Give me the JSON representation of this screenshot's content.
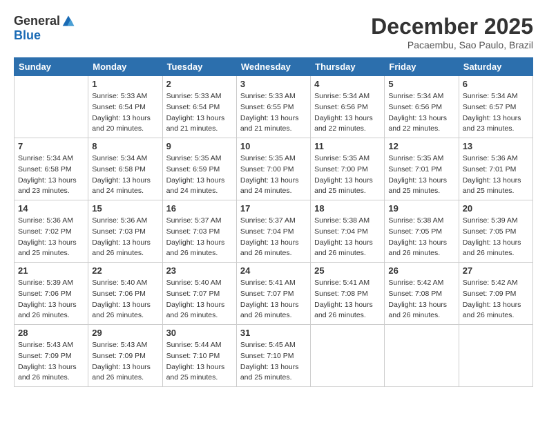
{
  "header": {
    "logo_general": "General",
    "logo_blue": "Blue",
    "month": "December 2025",
    "location": "Pacaembu, Sao Paulo, Brazil"
  },
  "weekdays": [
    "Sunday",
    "Monday",
    "Tuesday",
    "Wednesday",
    "Thursday",
    "Friday",
    "Saturday"
  ],
  "weeks": [
    [
      {
        "day": "",
        "info": ""
      },
      {
        "day": "1",
        "info": "Sunrise: 5:33 AM\nSunset: 6:54 PM\nDaylight: 13 hours\nand 20 minutes."
      },
      {
        "day": "2",
        "info": "Sunrise: 5:33 AM\nSunset: 6:54 PM\nDaylight: 13 hours\nand 21 minutes."
      },
      {
        "day": "3",
        "info": "Sunrise: 5:33 AM\nSunset: 6:55 PM\nDaylight: 13 hours\nand 21 minutes."
      },
      {
        "day": "4",
        "info": "Sunrise: 5:34 AM\nSunset: 6:56 PM\nDaylight: 13 hours\nand 22 minutes."
      },
      {
        "day": "5",
        "info": "Sunrise: 5:34 AM\nSunset: 6:56 PM\nDaylight: 13 hours\nand 22 minutes."
      },
      {
        "day": "6",
        "info": "Sunrise: 5:34 AM\nSunset: 6:57 PM\nDaylight: 13 hours\nand 23 minutes."
      }
    ],
    [
      {
        "day": "7",
        "info": "Sunrise: 5:34 AM\nSunset: 6:58 PM\nDaylight: 13 hours\nand 23 minutes."
      },
      {
        "day": "8",
        "info": "Sunrise: 5:34 AM\nSunset: 6:58 PM\nDaylight: 13 hours\nand 24 minutes."
      },
      {
        "day": "9",
        "info": "Sunrise: 5:35 AM\nSunset: 6:59 PM\nDaylight: 13 hours\nand 24 minutes."
      },
      {
        "day": "10",
        "info": "Sunrise: 5:35 AM\nSunset: 7:00 PM\nDaylight: 13 hours\nand 24 minutes."
      },
      {
        "day": "11",
        "info": "Sunrise: 5:35 AM\nSunset: 7:00 PM\nDaylight: 13 hours\nand 25 minutes."
      },
      {
        "day": "12",
        "info": "Sunrise: 5:35 AM\nSunset: 7:01 PM\nDaylight: 13 hours\nand 25 minutes."
      },
      {
        "day": "13",
        "info": "Sunrise: 5:36 AM\nSunset: 7:01 PM\nDaylight: 13 hours\nand 25 minutes."
      }
    ],
    [
      {
        "day": "14",
        "info": "Sunrise: 5:36 AM\nSunset: 7:02 PM\nDaylight: 13 hours\nand 25 minutes."
      },
      {
        "day": "15",
        "info": "Sunrise: 5:36 AM\nSunset: 7:03 PM\nDaylight: 13 hours\nand 26 minutes."
      },
      {
        "day": "16",
        "info": "Sunrise: 5:37 AM\nSunset: 7:03 PM\nDaylight: 13 hours\nand 26 minutes."
      },
      {
        "day": "17",
        "info": "Sunrise: 5:37 AM\nSunset: 7:04 PM\nDaylight: 13 hours\nand 26 minutes."
      },
      {
        "day": "18",
        "info": "Sunrise: 5:38 AM\nSunset: 7:04 PM\nDaylight: 13 hours\nand 26 minutes."
      },
      {
        "day": "19",
        "info": "Sunrise: 5:38 AM\nSunset: 7:05 PM\nDaylight: 13 hours\nand 26 minutes."
      },
      {
        "day": "20",
        "info": "Sunrise: 5:39 AM\nSunset: 7:05 PM\nDaylight: 13 hours\nand 26 minutes."
      }
    ],
    [
      {
        "day": "21",
        "info": "Sunrise: 5:39 AM\nSunset: 7:06 PM\nDaylight: 13 hours\nand 26 minutes."
      },
      {
        "day": "22",
        "info": "Sunrise: 5:40 AM\nSunset: 7:06 PM\nDaylight: 13 hours\nand 26 minutes."
      },
      {
        "day": "23",
        "info": "Sunrise: 5:40 AM\nSunset: 7:07 PM\nDaylight: 13 hours\nand 26 minutes."
      },
      {
        "day": "24",
        "info": "Sunrise: 5:41 AM\nSunset: 7:07 PM\nDaylight: 13 hours\nand 26 minutes."
      },
      {
        "day": "25",
        "info": "Sunrise: 5:41 AM\nSunset: 7:08 PM\nDaylight: 13 hours\nand 26 minutes."
      },
      {
        "day": "26",
        "info": "Sunrise: 5:42 AM\nSunset: 7:08 PM\nDaylight: 13 hours\nand 26 minutes."
      },
      {
        "day": "27",
        "info": "Sunrise: 5:42 AM\nSunset: 7:09 PM\nDaylight: 13 hours\nand 26 minutes."
      }
    ],
    [
      {
        "day": "28",
        "info": "Sunrise: 5:43 AM\nSunset: 7:09 PM\nDaylight: 13 hours\nand 26 minutes."
      },
      {
        "day": "29",
        "info": "Sunrise: 5:43 AM\nSunset: 7:09 PM\nDaylight: 13 hours\nand 26 minutes."
      },
      {
        "day": "30",
        "info": "Sunrise: 5:44 AM\nSunset: 7:10 PM\nDaylight: 13 hours\nand 25 minutes."
      },
      {
        "day": "31",
        "info": "Sunrise: 5:45 AM\nSunset: 7:10 PM\nDaylight: 13 hours\nand 25 minutes."
      },
      {
        "day": "",
        "info": ""
      },
      {
        "day": "",
        "info": ""
      },
      {
        "day": "",
        "info": ""
      }
    ]
  ]
}
